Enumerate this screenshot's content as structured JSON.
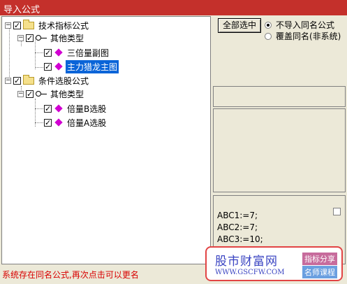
{
  "window": {
    "title": "导入公式"
  },
  "tree": {
    "nodes": [
      {
        "label": "技术指标公式"
      },
      {
        "label": "其他类型"
      },
      {
        "label": "三倍量副图"
      },
      {
        "label": "主力猎龙主图"
      },
      {
        "label": "条件选股公式"
      },
      {
        "label": "其他类型"
      },
      {
        "label": "倍量B选股"
      },
      {
        "label": "倍量A选股"
      }
    ],
    "selected_index": 3
  },
  "actions": {
    "select_all_label": "全部选中"
  },
  "options": {
    "no_import_label": "不导入同名公式",
    "overwrite_label": "覆盖同名(非系统)",
    "selected": "no_import"
  },
  "code": {
    "lines": [
      "ABC1:=7;",
      "ABC2:=7;",
      "ABC3:=10;"
    ]
  },
  "status": {
    "message": "系统存在同名公式,再次点击可以更名"
  },
  "watermark": {
    "main": "股市财富网",
    "url": "WWW.GSCFW.COM",
    "tag1": "指标分享",
    "tag2": "名师课程"
  }
}
